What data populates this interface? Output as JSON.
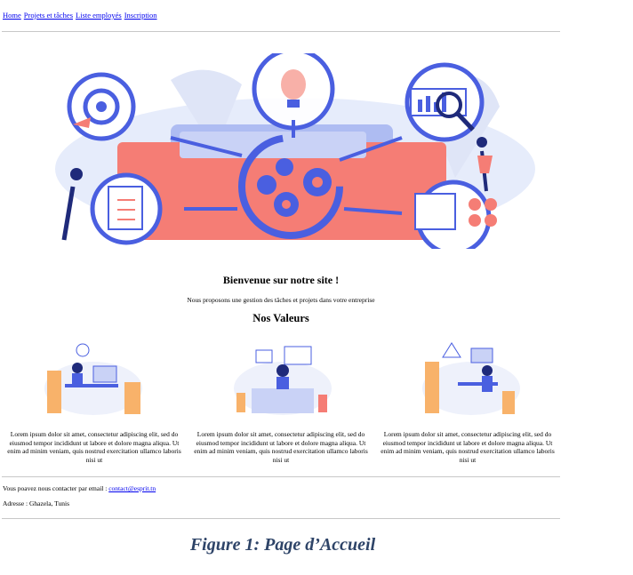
{
  "nav": {
    "links": [
      "Home",
      "Projets et tâches",
      "Liste employés",
      "Inscription"
    ]
  },
  "hero": {
    "image_alt": "project-management-illustration"
  },
  "main": {
    "title": "Bienvenue sur notre site !",
    "subtitle": "Nous proposons une gestion des tâches et projets dans votre entreprise",
    "values_heading": "Nos Valeurs",
    "cards": [
      {
        "text": "Lorem ipsum dolor sit amet, consectetur adipiscing elit, sed do eiusmod tempor incididunt ut labore et dolore magna aliqua. Ut enim ad minim veniam, quis nostrud exercitation ullamco laboris nisi ut"
      },
      {
        "text": "Lorem ipsum dolor sit amet, consectetur adipiscing elit, sed do eiusmod tempor incididunt ut labore et dolore magna aliqua. Ut enim ad minim veniam, quis nostrud exercitation ullamco laboris nisi ut"
      },
      {
        "text": "Lorem ipsum dolor sit amet, consectetur adipiscing elit, sed do eiusmod tempor incididunt ut labore et dolore magna aliqua. Ut enim ad minim veniam, quis nostrud exercitation ullamco laboris nisi ut"
      }
    ]
  },
  "footer": {
    "contact_prefix": "Vous poavez nous contacter par email : ",
    "contact_email": "contact@esprit.tn",
    "address": "Adresse : Ghazela, Tunis"
  },
  "caption": "Figure 1: Page d’Accueil",
  "colors": {
    "link": "#0000ee",
    "caption": "#2e4468",
    "accent_blue": "#4a5fe0",
    "accent_coral": "#f57d75"
  }
}
